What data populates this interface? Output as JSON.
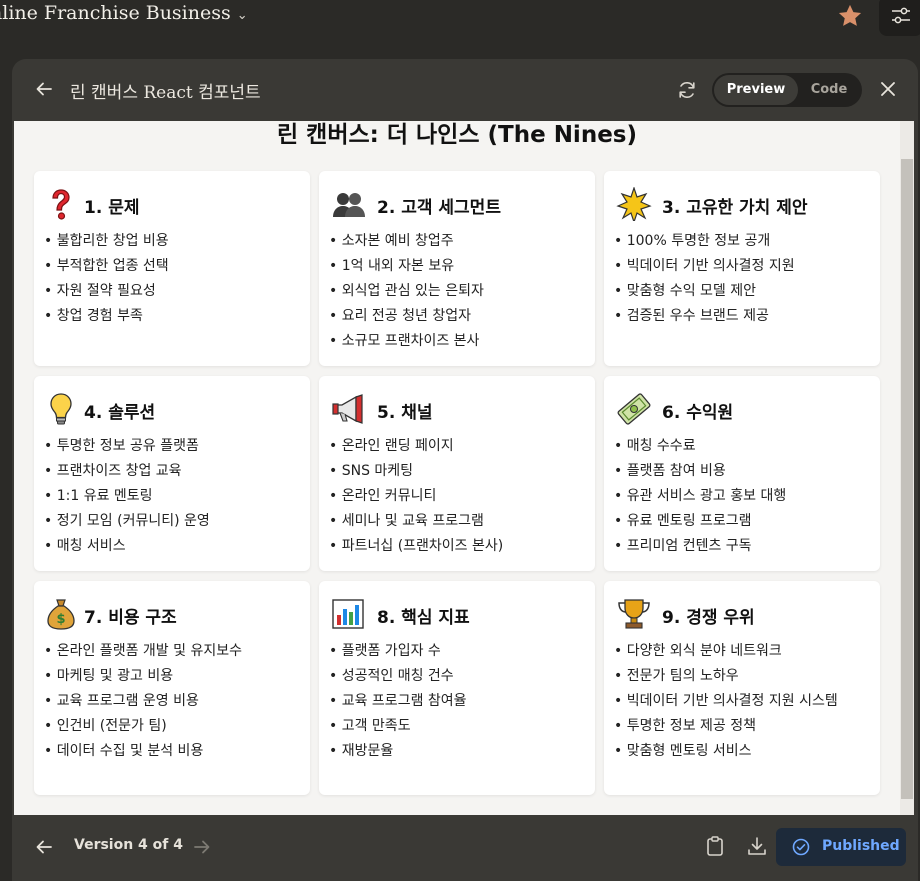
{
  "top": {
    "project_title": "nline Franchise Business"
  },
  "panel": {
    "artifact_title": "린 캔버스 React 컴포넌트",
    "toggle": {
      "preview": "Preview",
      "code": "Code"
    }
  },
  "canvas": {
    "title": "린 캔버스: 더 나인스 (The Nines)",
    "cards": [
      {
        "icon": "question-mark-icon",
        "title": "1. 문제",
        "items": [
          "불합리한 창업 비용",
          "부적합한 업종 선택",
          "자원 절약 필요성",
          "창업 경험 부족"
        ]
      },
      {
        "icon": "people-icon",
        "title": "2. 고객 세그먼트",
        "items": [
          "소자본 예비 창업주",
          "1억 내외 자본 보유",
          "외식업 관심 있는 은퇴자",
          "요리 전공 청년 창업자",
          "소규모 프랜차이즈 본사"
        ]
      },
      {
        "icon": "star-burst-icon",
        "title": "3. 고유한 가치 제안",
        "items": [
          "100% 투명한 정보 공개",
          "빅데이터 기반 의사결정 지원",
          "맞춤형 수익 모델 제안",
          "검증된 우수 브랜드 제공"
        ]
      },
      {
        "icon": "lightbulb-icon",
        "title": "4. 솔루션",
        "items": [
          "투명한 정보 공유 플랫폼",
          "프랜차이즈 창업 교육",
          "1:1 유료 멘토링",
          "정기 모임 (커뮤니티) 운영",
          "매칭 서비스"
        ]
      },
      {
        "icon": "megaphone-icon",
        "title": "5. 채널",
        "items": [
          "온라인 랜딩 페이지",
          "SNS 마케팅",
          "온라인 커뮤니티",
          "세미나 및 교육 프로그램",
          "파트너십 (프랜차이즈 본사)"
        ]
      },
      {
        "icon": "money-bill-icon",
        "title": "6. 수익원",
        "items": [
          "매칭 수수료",
          "플랫폼 참여 비용",
          "유관 서비스 광고 홍보 대행",
          "유료 멘토링 프로그램",
          "프리미엄 컨텐츠 구독"
        ]
      },
      {
        "icon": "money-bag-icon",
        "title": "7. 비용 구조",
        "items": [
          "온라인 플랫폼 개발 및 유지보수",
          "마케팅 및 광고 비용",
          "교육 프로그램 운영 비용",
          "인건비 (전문가 팀)",
          "데이터 수집 및 분석 비용"
        ]
      },
      {
        "icon": "bar-chart-icon",
        "title": "8. 핵심 지표",
        "items": [
          "플랫폼 가입자 수",
          "성공적인 매칭 건수",
          "교육 프로그램 참여율",
          "고객 만족도",
          "재방문율"
        ]
      },
      {
        "icon": "trophy-icon",
        "title": "9. 경쟁 우위",
        "items": [
          "다양한 외식 분야 네트워크",
          "전문가 팀의 노하우",
          "빅데이터 기반 의사결정 지원 시스템",
          "투명한 정보 제공 정책",
          "맞춤형 멘토링 서비스"
        ]
      }
    ]
  },
  "footer": {
    "version_label": "Version 4 of 4",
    "published_label": "Published"
  }
}
